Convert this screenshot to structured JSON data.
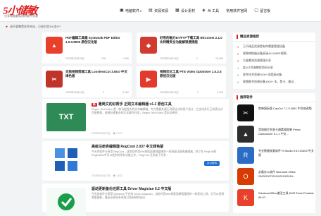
{
  "header": {
    "logo": "5小储敏",
    "logo_sub": "分享电脑最实用的软件资源",
    "nav": [
      {
        "label": "电脑软件",
        "icon": "computer-icon"
      },
      {
        "label": "资源资源",
        "icon": "folder-icon"
      },
      {
        "label": "设计素材",
        "icon": "design-icon"
      },
      {
        "label": "AI 工具",
        "icon": "ai-icon"
      },
      {
        "label": "常用软件官网",
        "icon": ""
      },
      {
        "label": "留言板",
        "icon": "message-icon"
      }
    ]
  },
  "notice": "请不要整置软件网站，已经封禁300多IP！",
  "cards": [
    {
      "title": "PDF编辑工具箱 Systweak PDF Editor 1.0.0.8000 原创汉化版",
      "date": "2025年05月15日",
      "comments": "206",
      "views": "1,960",
      "color": "#e8402a",
      "glyph": "▲"
    },
    {
      "title": "好用的磁力BT/FTP下载工具 BitComet 2.1.0 比特精灵全功能解锁便携版",
      "date": "2025年05月14日",
      "comments": "0",
      "views": "15,558",
      "color": "#d23c30",
      "glyph": "◆"
    },
    {
      "title": "无损视频剪辑工具 LosslessCut 3.65.0 中文绿色版",
      "date": "2025年05月14日",
      "comments": "0",
      "views": "3,082",
      "color": "#c0342a",
      "glyph": "✂"
    },
    {
      "title": "视频优化工具 PTE Video Optimiser 1.0.2.5 原创汉化版",
      "date": "2025年05月14日",
      "comments": "0",
      "views": "1,209",
      "color": "#e23a2c",
      "glyph": "▶"
    }
  ],
  "posts": [
    {
      "badge": "新",
      "title": "最简文的好帮手 正则文本编辑器 v1.2 原创工具",
      "desc": "Regex Text Editor 是一款功能强大的文本编辑器，专为需要处理正则表达式的用户设计，它支持多行正则表达式匹配替换，能够处理复杂的文本操作任务，Regex Text Editor 是本站原创...",
      "date": "2025年05月12日",
      "views": "2,217",
      "thumb_text": "TXT",
      "thumb_color": "#2e8b57"
    },
    {
      "badge": "",
      "title": "高级注册表编辑器 RegCool 2.037 中文绿色版",
      "desc": "今天的软件分享是 RegCool，这款软件是Win按版面增强整理的一款高级注册表编辑器，除了在 RegEdit和RegEdit32中可以找到的所有功能之外，RegCool 还添加了许多...",
      "date": "2025年05月12日",
      "views": "1,032",
      "thumb_text": "",
      "thumb_color": "#1f5fb8",
      "tag": "办公软件"
    },
    {
      "badge": "",
      "title": "驱动更新备份还原工具 Driver Magician 6.2 中文版",
      "desc": "今天的软件分享是 Windows 平台的 Driver Magician，该软件是Win按版面增强整理的一款驱动工具，它可以检测需要更新，备份还原现有系统已经安装的驱动...",
      "date": "",
      "views": "",
      "thumb_text": "",
      "thumb_color": "#1a9e4a"
    }
  ],
  "sidebar": {
    "ranking_title": "精品资源推荐",
    "ranking": [
      "万千精品资源是有你需要管理设备",
      "视频转换器必备高清4K/1080P视频...",
      "大量素材资源管理分享",
      "此10T资源教程资料分享",
      "软件技术资源1000+本提高必备",
      "视频图书资源必备1000+ 本，是卡、美记..."
    ],
    "apps_title": "推荐软件",
    "apps": [
      {
        "name": "剪映国际版 CapCut 7.1.0.2891 中文修改版",
        "color": "#111111",
        "glyph": "✂"
      },
      {
        "name": "音效图片秒变卡通素描效果 Prima Cartoonizer 5.1.1 中文...",
        "color": "#2d2d2d",
        "glyph": "▲"
      },
      {
        "name": "专业数据恢复软件 R-Studio 9.5.191600 中文版",
        "color": "#2b6cc4",
        "glyph": "R"
      },
      {
        "name": "必备办公软件 Microsoft Office 2003/2007/2010/2013/2016...",
        "color": "#d83b01",
        "glyph": "O"
      },
      {
        "name": "WindowsOffice激活工具 KMS Tools Portable 06.07...",
        "color": "#e8402a",
        "glyph": "K"
      }
    ]
  }
}
